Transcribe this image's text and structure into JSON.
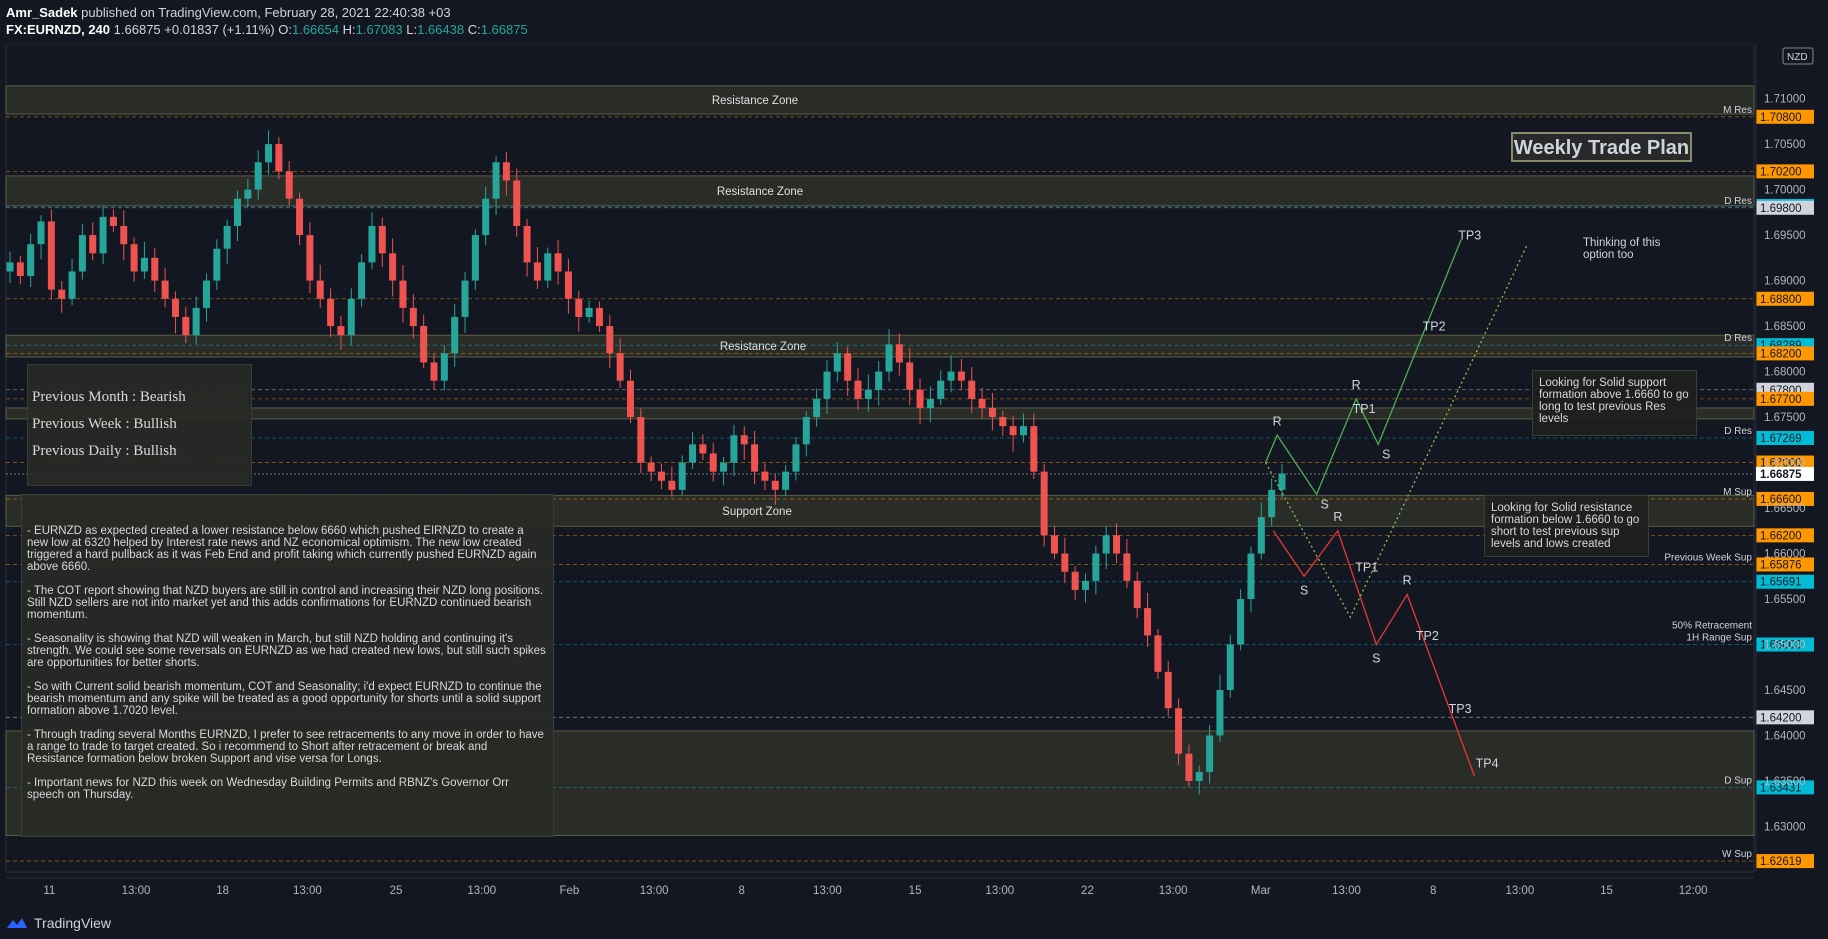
{
  "header": {
    "author": "Amr_Sadek",
    "published": "published on TradingView.com, February 28, 2021 22:40:38 +03",
    "symbol": "FX:EURNZD, 240",
    "last": "1.66875",
    "change": "+0.01837 (+1.11%)",
    "o_label": "O:",
    "o_value": "1.66654",
    "h_label": "H:",
    "h_value": "1.67083",
    "l_label": "L:",
    "l_value": "1.66438",
    "c_label": "C:",
    "c_value": "1.66875"
  },
  "footer": {
    "brand": "TradingView"
  },
  "currency_badge": "NZD",
  "weekly_plan": "Weekly Trade Plan",
  "bias": {
    "month": "Previous Month : Bearish",
    "week": "Previous Week : Bullish",
    "daily": "Previous Daily : Bullish"
  },
  "analysis": [
    "- EURNZD as expected created a lower resistance below 6660 which pushed EIRNZD to create a new low at 6320 helped by Interest rate news and NZ economical optimism. The new low created triggered a hard pullback as it was Feb End and profit taking which currently pushed EURNZD again above 6660.",
    "- The COT report showing that NZD buyers are still in control and increasing their NZD long positions. Still NZD sellers are not into market yet and this adds confirmations for EURNZD continued bearish momentum.",
    "-  Seasonality is showing that NZD will weaken in March, but still NZD holding and continuing it's strength. We could see some reversals on EURNZD as we had created new lows, but still such spikes are opportunities for better shorts.",
    "-  So with Current solid bearish momentum, COT and Seasonality; i'd expect EURNZD to continue the bearish momentum and any spike will be treated as a good opportunity for shorts until a solid support formation above 1.7020 level.",
    "- Through trading several Months EURNZD, I prefer to see retracements to any move in order to have a range to trade to target created. So i recommend to Short after retracement or break and Resistance formation below broken Support and vise versa for Longs.",
    "- Important news for NZD this week on Wednesday Building Permits and RBNZ's Governor Orr speech on Thursday."
  ],
  "notes": {
    "support": "Looking for Solid support formation above 1.6660 to go long to test previous Res levels",
    "resistance": "Looking for Solid resistance formation below 1.6660 to go short to test previous sup levels and lows created",
    "option": "Thinking of this option too"
  },
  "colors": {
    "background": "#131722",
    "bull": "#26a69a",
    "bear": "#ef5350",
    "zone": "#3a3a2c",
    "orange": "#ff9800",
    "cyan": "#00bcd4",
    "long_path": "#4caf50",
    "short_path": "#e53935"
  },
  "chart_data": {
    "type": "candlestick",
    "symbol": "FX:EURNZD",
    "interval": "240",
    "ylim": [
      1.625,
      1.716
    ],
    "y_ticks": [
      1.63,
      1.635,
      1.64,
      1.645,
      1.65,
      1.655,
      1.66,
      1.665,
      1.67,
      1.675,
      1.68,
      1.685,
      1.69,
      1.695,
      1.7,
      1.705,
      1.71
    ],
    "y_tick_labels": [
      "1.63000",
      "1.63500",
      "1.64000",
      "1.64500",
      "1.65000",
      "1.65500",
      "1.66000",
      "1.66500",
      "1.67000",
      "1.67500",
      "1.68000",
      "1.68500",
      "1.69000",
      "1.69500",
      "1.70000",
      "1.70500",
      "1.71000"
    ],
    "x_tick_labels": [
      "11",
      "13:00",
      "18",
      "13:00",
      "25",
      "13:00",
      "Feb",
      "13:00",
      "8",
      "13:00",
      "15",
      "13:00",
      "22",
      "13:00",
      "Mar",
      "13:00",
      "8",
      "13:00",
      "15",
      "12:00"
    ],
    "x_tick_pos": [
      0.045,
      0.135,
      0.225,
      0.313,
      0.405,
      0.494,
      0.585,
      0.673,
      0.764,
      0.853,
      0.944,
      1.032,
      1.123,
      1.212,
      1.303,
      1.392,
      1.482,
      1.572,
      1.662,
      1.752
    ],
    "closes": [
      1.692,
      1.6905,
      1.694,
      1.6965,
      1.689,
      1.688,
      1.691,
      1.695,
      1.693,
      1.697,
      1.696,
      1.694,
      1.691,
      1.6925,
      1.69,
      1.688,
      1.686,
      1.684,
      1.687,
      1.69,
      1.6935,
      1.696,
      1.699,
      1.7,
      1.703,
      1.705,
      1.702,
      1.699,
      1.695,
      1.69,
      1.688,
      1.685,
      1.684,
      1.688,
      1.692,
      1.696,
      1.693,
      1.69,
      1.687,
      1.685,
      1.681,
      1.679,
      1.682,
      1.686,
      1.69,
      1.695,
      1.699,
      1.703,
      1.701,
      1.696,
      1.692,
      1.69,
      1.693,
      1.691,
      1.688,
      1.686,
      1.687,
      1.685,
      1.682,
      1.679,
      1.675,
      1.67,
      1.669,
      1.668,
      1.667,
      1.67,
      1.672,
      1.671,
      1.669,
      1.67,
      1.673,
      1.672,
      1.669,
      1.668,
      1.667,
      1.669,
      1.672,
      1.675,
      1.677,
      1.68,
      1.682,
      1.679,
      1.677,
      1.678,
      1.68,
      1.683,
      1.681,
      1.678,
      1.676,
      1.677,
      1.679,
      1.68,
      1.679,
      1.677,
      1.676,
      1.675,
      1.674,
      1.673,
      1.674,
      1.669,
      1.662,
      1.66,
      1.658,
      1.656,
      1.657,
      1.66,
      1.662,
      1.66,
      1.657,
      1.654,
      1.651,
      1.647,
      1.643,
      1.638,
      1.635,
      1.636,
      1.64,
      1.645,
      1.65,
      1.655,
      1.66,
      1.664,
      1.667,
      1.6688
    ],
    "levels": [
      {
        "price": 1.708,
        "label": "1.70800",
        "tag": "M Res",
        "color": "#ff9800"
      },
      {
        "price": 1.702,
        "label": "1.70200",
        "tag": "",
        "color": "#ff9800"
      },
      {
        "price": 1.6982,
        "label": "1.69820",
        "tag": "",
        "color": "#00bcd4"
      },
      {
        "price": 1.698,
        "label": "1.69800",
        "tag": "D Res",
        "color": "#d1d4dc"
      },
      {
        "price": 1.688,
        "label": "1.68800",
        "tag": "",
        "color": "#ff9800"
      },
      {
        "price": 1.6829,
        "label": "1.68289",
        "tag": "D Res",
        "color": "#00bcd4"
      },
      {
        "price": 1.682,
        "label": "1.68200",
        "tag": "",
        "color": "#ff9800"
      },
      {
        "price": 1.678,
        "label": "1.67800",
        "tag": "",
        "color": "#d1d4dc"
      },
      {
        "price": 1.677,
        "label": "1.67700",
        "tag": "",
        "color": "#ff9800"
      },
      {
        "price": 1.6727,
        "label": "1.67269",
        "tag": "D Res",
        "color": "#00bcd4"
      },
      {
        "price": 1.67,
        "label": "1.67000",
        "tag": "",
        "color": "#ff9800"
      },
      {
        "price": 1.666,
        "label": "1.66600",
        "tag": "M Sup",
        "color": "#ff9800"
      },
      {
        "price": 1.662,
        "label": "1.66200",
        "tag": "",
        "color": "#ff9800"
      },
      {
        "price": 1.6588,
        "label": "1.65876",
        "tag": "Previous Week Sup",
        "color": "#ff9800"
      },
      {
        "price": 1.6569,
        "label": "1.65691",
        "tag": "",
        "color": "#00bcd4"
      },
      {
        "price": 1.65,
        "label": "1.65003",
        "tag": "50% Retracement\n1H Range Sup",
        "color": "#00bcd4"
      },
      {
        "price": 1.642,
        "label": "1.64200",
        "tag": "",
        "color": "#d1d4dc"
      },
      {
        "price": 1.6343,
        "label": "1.63431",
        "tag": "D Sup",
        "color": "#00bcd4"
      },
      {
        "price": 1.6262,
        "label": "1.62619",
        "tag": "W Sup",
        "color": "#ff9800"
      }
    ],
    "current_price": {
      "price": 1.66875,
      "label": "1.66875"
    },
    "zones": [
      {
        "top": 1.7114,
        "bottom": 1.7083,
        "label": "Resistance Zone"
      },
      {
        "top": 1.7015,
        "bottom": 1.6982,
        "label": "Resistance Zone"
      },
      {
        "top": 1.684,
        "bottom": 1.6816,
        "label": "Resistance Zone"
      },
      {
        "top": 1.676,
        "bottom": 1.6748,
        "label": ""
      },
      {
        "top": 1.6664,
        "bottom": 1.663,
        "label": "Support Zone"
      },
      {
        "top": 1.6405,
        "bottom": 1.629,
        "label": ""
      }
    ],
    "long_path": {
      "points": [
        [
          1.308,
          1.67
        ],
        [
          1.32,
          1.673
        ],
        [
          1.361,
          1.6665
        ],
        [
          1.402,
          1.677
        ],
        [
          1.425,
          1.672
        ],
        [
          1.511,
          1.6945
        ]
      ],
      "labels": [
        {
          "t": "R",
          "i": 1,
          "pos": "above"
        },
        {
          "t": "S",
          "i": 2,
          "pos": "right"
        },
        {
          "t": "R",
          "i": 3,
          "pos": "above"
        },
        {
          "t": "TP1",
          "i": 3,
          "pos": "right"
        },
        {
          "t": "S",
          "i": 4,
          "pos": "right"
        },
        {
          "t": "TP2",
          "px": [
            1.483,
            1.6845
          ]
        },
        {
          "t": "TP3",
          "px": [
            1.52,
            1.6945
          ]
        }
      ]
    },
    "short_path": {
      "points": [
        [
          1.316,
          1.6625
        ],
        [
          1.348,
          1.6575
        ],
        [
          1.383,
          1.6625
        ],
        [
          1.423,
          1.65
        ],
        [
          1.455,
          1.6555
        ],
        [
          1.525,
          1.6355
        ]
      ],
      "labels": [
        {
          "t": "S",
          "i": 1,
          "pos": "below"
        },
        {
          "t": "R",
          "i": 2,
          "pos": "above"
        },
        {
          "t": "TP1",
          "px": [
            1.413,
            1.658
          ]
        },
        {
          "t": "R",
          "i": 4,
          "pos": "above"
        },
        {
          "t": "S",
          "i": 3,
          "pos": "below"
        },
        {
          "t": "TP2",
          "px": [
            1.476,
            1.6505
          ]
        },
        {
          "t": "TP3",
          "px": [
            1.51,
            1.6425
          ]
        },
        {
          "t": "TP4",
          "px": [
            1.538,
            1.6365
          ]
        }
      ]
    },
    "option_path": {
      "points": [
        [
          1.308,
          1.67
        ],
        [
          1.396,
          1.653
        ],
        [
          1.58,
          1.694
        ]
      ]
    }
  }
}
